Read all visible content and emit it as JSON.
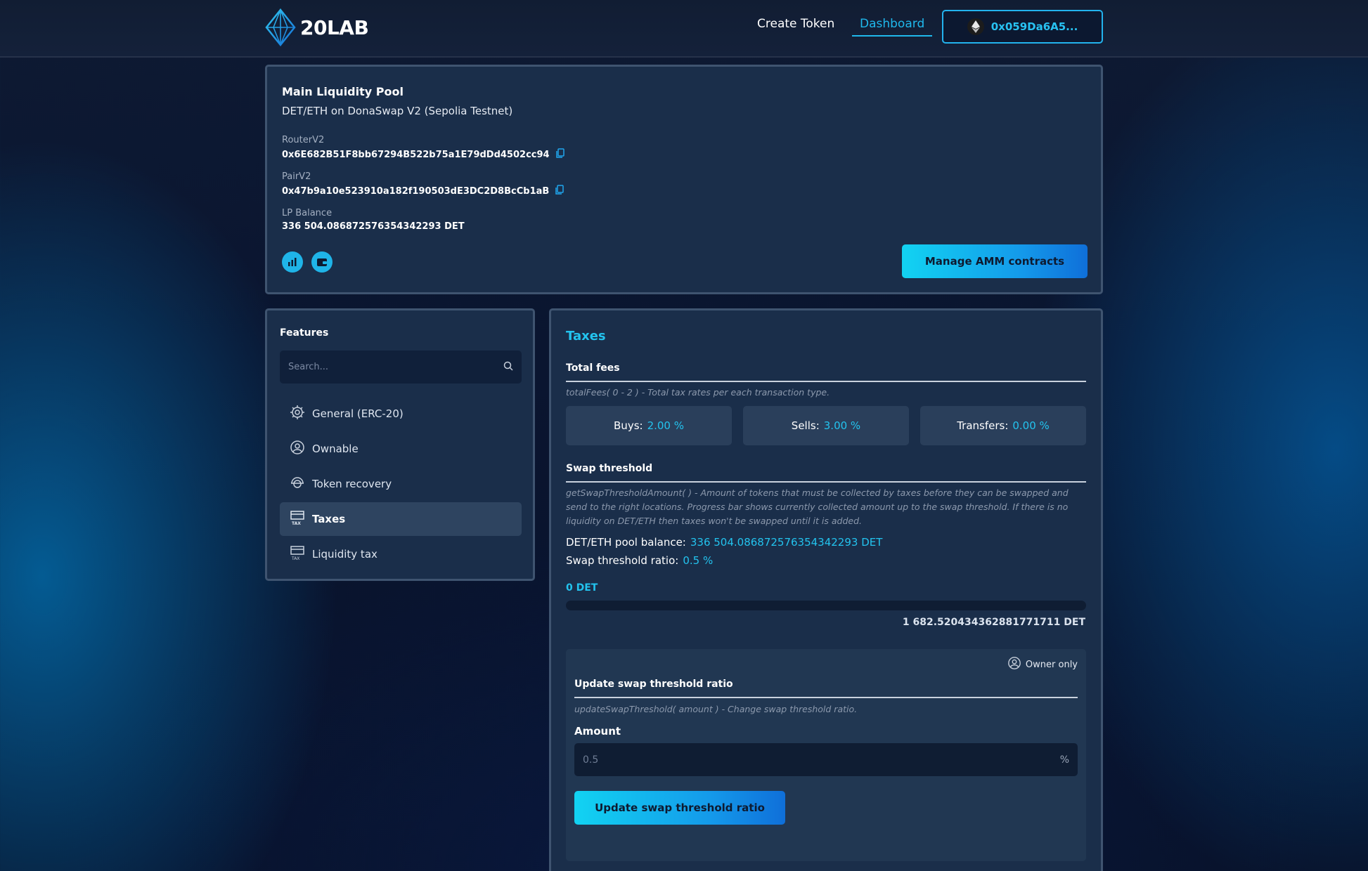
{
  "header": {
    "logo_text": "20LAB",
    "nav": {
      "create_token": "Create Token",
      "dashboard": "Dashboard"
    },
    "wallet_address": "0x059Da6A5..."
  },
  "pool": {
    "title": "Main Liquidity Pool",
    "subtitle": "DET/ETH on DonaSwap V2 (Sepolia Testnet)",
    "router_label": "RouterV2",
    "router_value": "0x6E682B51F8bb67294B522b75a1E79dDd4502cc94",
    "pair_label": "PairV2",
    "pair_value": "0x47b9a10e523910a182f190503dE3DC2D8BcCb1aB",
    "lp_label": "LP Balance",
    "lp_value": "336 504.086872576354342293 DET",
    "manage_button": "Manage AMM contracts"
  },
  "features": {
    "title": "Features",
    "search_placeholder": "Search...",
    "items": [
      {
        "label": "General (ERC-20)",
        "icon": "gear-chip-icon",
        "active": false
      },
      {
        "label": "Ownable",
        "icon": "user-circle-icon",
        "active": false
      },
      {
        "label": "Token recovery",
        "icon": "rescue-icon",
        "active": false
      },
      {
        "label": "Taxes",
        "icon": "tax-icon",
        "active": true
      },
      {
        "label": "Liquidity tax",
        "icon": "tax-icon",
        "active": false
      }
    ]
  },
  "taxes": {
    "title": "Taxes",
    "total_fees_title": "Total fees",
    "total_fees_desc": "totalFees( 0 - 2 ) - Total tax rates per each transaction type.",
    "fees": [
      {
        "label": "Buys:",
        "value": "2.00 %"
      },
      {
        "label": "Sells:",
        "value": "3.00 %"
      },
      {
        "label": "Transfers:",
        "value": "0.00 %"
      }
    ],
    "swap_title": "Swap threshold",
    "swap_desc": "getSwapThresholdAmount( ) - Amount of tokens that must be collected by taxes before they can be swapped and send to the right locations. Progress bar shows currently collected amount up to the swap threshold. If there is no liquidity on DET/ETH then taxes won't be swapped until it is added.",
    "pool_balance_label": "DET/ETH pool balance:",
    "pool_balance_value": "336 504.086872576354342293 DET",
    "ratio_label": "Swap threshold ratio:",
    "ratio_value": "0.5 %",
    "collected": "0 DET",
    "progress_fraction": 0,
    "threshold_max": "1 682.520434362881771711 DET",
    "update": {
      "owner_only": "Owner only",
      "title": "Update swap threshold ratio",
      "desc": "updateSwapThreshold( amount ) - Change swap threshold ratio.",
      "amount_label": "Amount",
      "amount_placeholder": "0.5",
      "amount_unit": "%",
      "button": "Update swap threshold ratio"
    }
  },
  "colors": {
    "accent": "#23c3ee",
    "panel": "#1a2e4a",
    "panel_border": "#3f5470"
  }
}
